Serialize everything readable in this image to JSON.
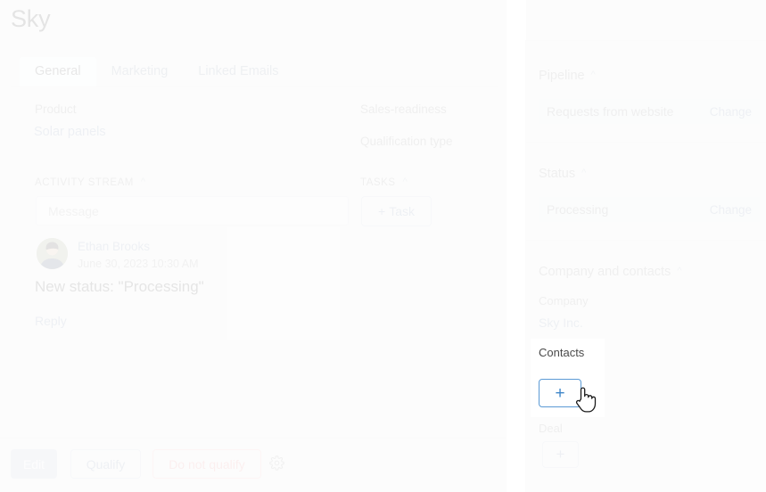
{
  "window": {
    "title": "Sky",
    "icons": [
      {
        "name": "notifications-off-icon",
        "glyph": "bell-slash"
      },
      {
        "name": "document-add-icon",
        "glyph": "doc-plus"
      },
      {
        "name": "expand-icon",
        "glyph": "expand"
      },
      {
        "name": "close-icon",
        "glyph": "close"
      }
    ]
  },
  "tabs": [
    {
      "label": "General",
      "active": true
    },
    {
      "label": "Marketing",
      "active": false
    },
    {
      "label": "Linked Emails",
      "active": false
    }
  ],
  "fields": {
    "product_label": "Product",
    "product_value": "Solar panels",
    "sales_readiness_label": "Sales-readiness",
    "qualification_type_label": "Qualification type"
  },
  "activity": {
    "section_title": "ACTIVITY STREAM",
    "message_placeholder": "Message",
    "entry": {
      "author": "Ethan Brooks",
      "timestamp": "June 30, 2023 10:30 AM",
      "title": "New status: \"Processing\"",
      "reply_label": "Reply"
    }
  },
  "tasks": {
    "section_title": "TASKS",
    "add_task_label": "Task",
    "add_task_plus": "+"
  },
  "footer": {
    "edit_label": "Edit",
    "qualify_label": "Qualify",
    "do_not_qualify_label": "Do not qualify",
    "settings_icon": "gear-icon"
  },
  "sidebar": {
    "pipeline": {
      "header": "Pipeline",
      "value": "Requests from website",
      "change_label": "Change"
    },
    "status": {
      "header": "Status",
      "value": "Processing",
      "change_label": "Change"
    },
    "company_and_contacts": {
      "header": "Company and contacts",
      "company_label": "Company",
      "company_value": "Sky Inc.",
      "contacts_label": "Contacts",
      "contacts_add_plus": "+",
      "deal_label": "Deal",
      "deal_add_plus": "+"
    }
  },
  "colors": {
    "page_bg": "#eeeeee",
    "accent_blue": "#7f95b0",
    "highlight_blue": "#5b9ad5",
    "danger_red": "#e58c8c",
    "chip_bg": "#e3e9ef",
    "spotlight_bg": "#ffffff"
  }
}
